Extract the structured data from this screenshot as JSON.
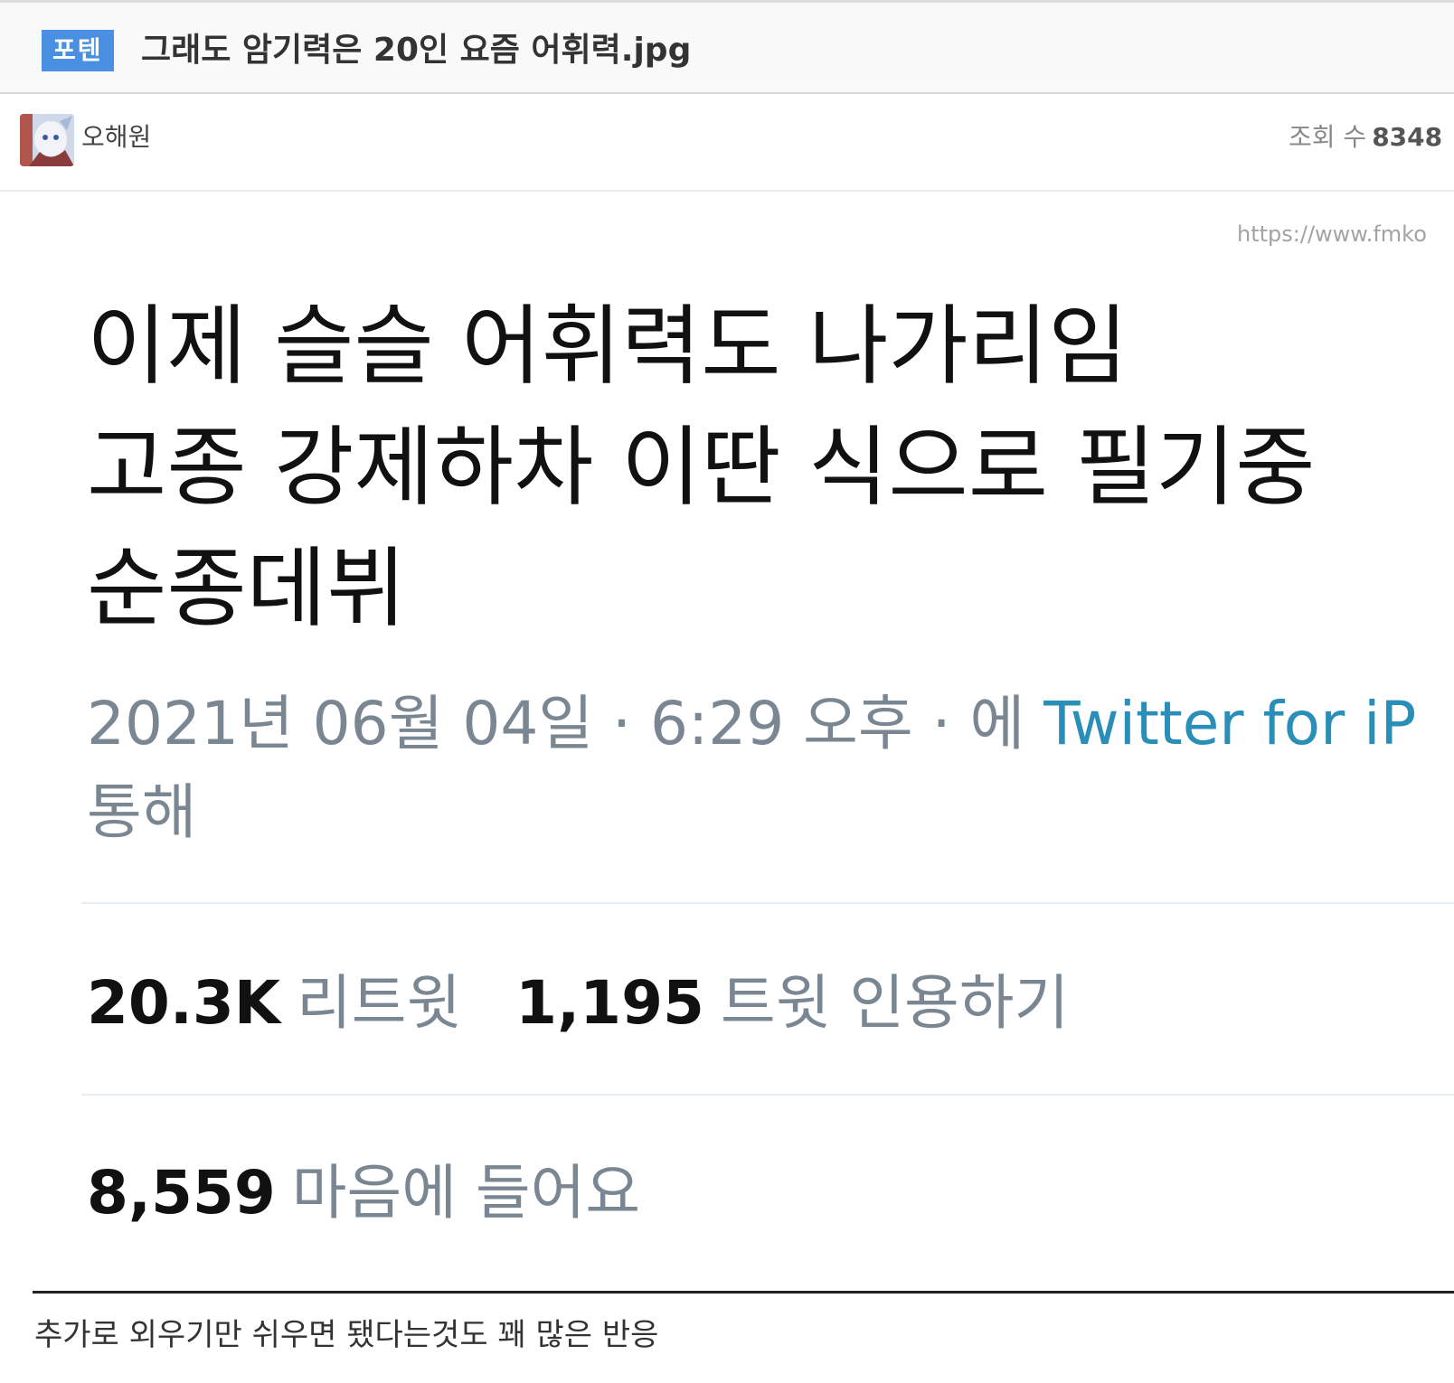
{
  "post": {
    "category": "포텐",
    "title": "그래도 암기력은 20인 요즘 어휘력.jpg"
  },
  "author": {
    "name": "오해원",
    "views_label": "조회 수",
    "views_value": "8348"
  },
  "source_url": "https://www.fmko",
  "tweet": {
    "lines": [
      "이제 슬슬 어휘력도 나가리임",
      "고종 강제하차 이딴 식으로 필기중",
      "순종데뷔"
    ],
    "meta_prefix": "2021년 06월 04일 · 6:29 오후 · 에",
    "meta_link": "Twitter for iP",
    "meta_suffix": "통해",
    "retweets_value": "20.3K",
    "retweets_label": "리트윗",
    "quotes_value": "1,195",
    "quotes_label": "트윗 인용하기",
    "likes_value": "8,559",
    "likes_label": "마음에 들어요"
  },
  "caption": "추가로 외우기만 쉬우면 됐다는것도 꽤 많은 반응",
  "colors": {
    "badge_bg": "#4a90e2",
    "twitter_link": "#2a8fb8",
    "meta_gray": "#7a8793"
  }
}
